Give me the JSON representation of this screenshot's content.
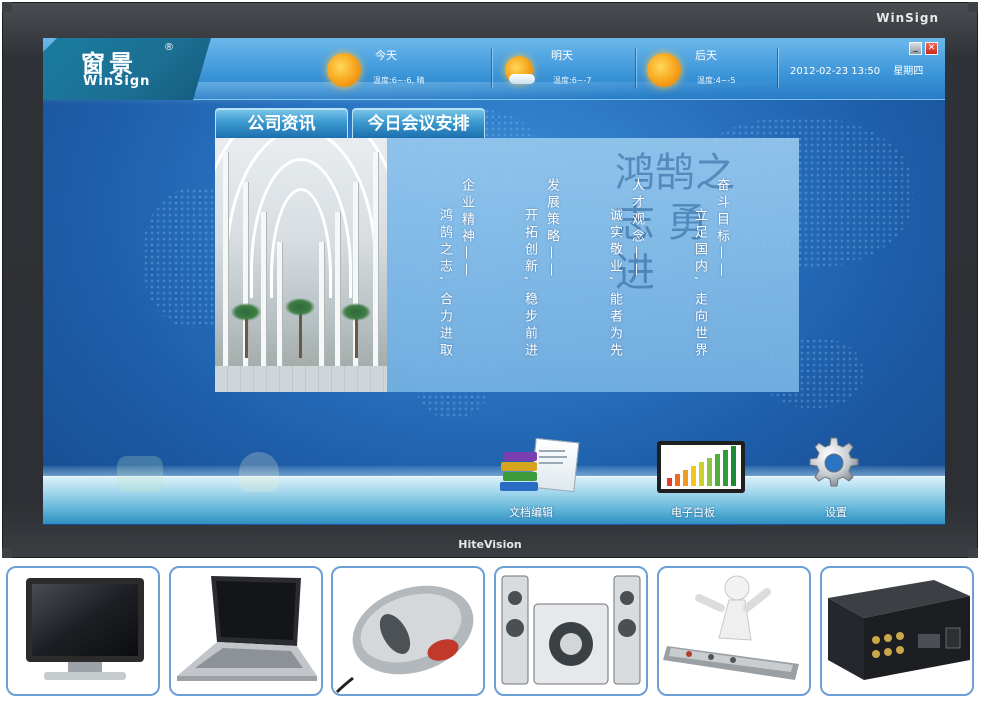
{
  "bezel": {
    "top_brand": "WinSign",
    "bottom_brand": "HiteVision"
  },
  "logo": {
    "cn": "窗景",
    "registered": "®",
    "en": "WinSign"
  },
  "weather": [
    {
      "day": "今天",
      "temp": "温度:6~-6, 晴",
      "icon": "sun-icon"
    },
    {
      "day": "明天",
      "temp": "温度:6~-7",
      "icon": "sun-cloud-icon"
    },
    {
      "day": "后天",
      "temp": "温度:4~-5",
      "icon": "sun-icon"
    }
  ],
  "clock": {
    "datetime": "2012-02-23  13:50",
    "weekday": "星期四"
  },
  "window_controls": {
    "minimize": "_",
    "close": "✕"
  },
  "tabs": [
    {
      "label": "公司资讯"
    },
    {
      "label": "今日会议安排"
    }
  ],
  "values": [
    {
      "heading": "企业精神——",
      "body": "鸿鹄之志, 合力进取"
    },
    {
      "heading": "发展策略——",
      "body": "开拓创新, 稳步前进"
    },
    {
      "heading": "人才观念——",
      "body": "诚实敬业, 能者为先"
    },
    {
      "heading": "奋斗目标——",
      "body": "立足国内, 走向世界"
    }
  ],
  "calligraphy": "鸿鹄之志 勇进",
  "dock": [
    {
      "label": "文档编辑",
      "icon": "books-document-icon"
    },
    {
      "label": "电子白板",
      "icon": "whiteboard-chart-icon"
    },
    {
      "label": "设置",
      "icon": "gear-icon"
    }
  ],
  "devices": [
    {
      "name": "flat-panel-tv"
    },
    {
      "name": "laptop"
    },
    {
      "name": "computer-mouse"
    },
    {
      "name": "speaker-system"
    },
    {
      "name": "remote-control"
    },
    {
      "name": "hardware-box"
    }
  ],
  "colors": {
    "screen_blue": "#2a74c2",
    "shelf": "#a8d9ee",
    "tile_border": "#6c9fd4",
    "bezel": "#2f3236"
  }
}
